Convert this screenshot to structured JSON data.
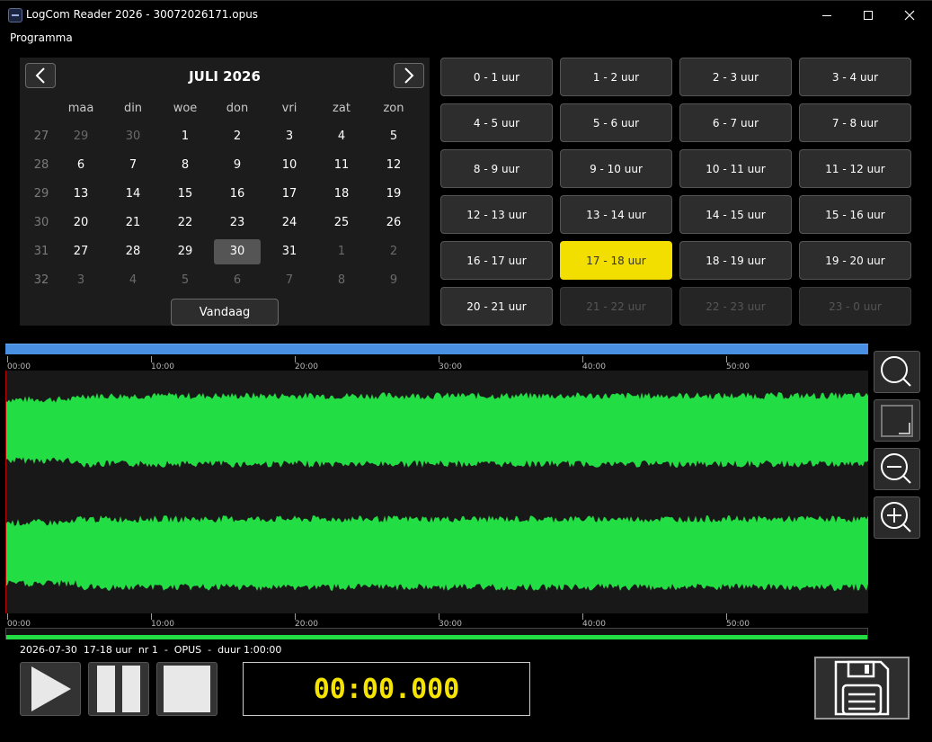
{
  "window": {
    "title": "LogCom Reader 2026  -  30072026171.opus",
    "icon": "app-icon",
    "controls": [
      "minimize-icon",
      "maximize-icon",
      "close-icon"
    ]
  },
  "menu": {
    "items": [
      "Programma"
    ]
  },
  "calendar": {
    "month_label": "JULI 2026",
    "weekday_headers": [
      "maa",
      "din",
      "woe",
      "don",
      "vri",
      "zat",
      "zon"
    ],
    "weeks": [
      {
        "week": "27",
        "days": [
          {
            "d": "29",
            "other": true
          },
          {
            "d": "30",
            "other": true
          },
          {
            "d": "1"
          },
          {
            "d": "2"
          },
          {
            "d": "3"
          },
          {
            "d": "4"
          },
          {
            "d": "5"
          }
        ]
      },
      {
        "week": "28",
        "days": [
          {
            "d": "6"
          },
          {
            "d": "7"
          },
          {
            "d": "8"
          },
          {
            "d": "9"
          },
          {
            "d": "10"
          },
          {
            "d": "11"
          },
          {
            "d": "12"
          }
        ]
      },
      {
        "week": "29",
        "days": [
          {
            "d": "13"
          },
          {
            "d": "14"
          },
          {
            "d": "15"
          },
          {
            "d": "16"
          },
          {
            "d": "17"
          },
          {
            "d": "18"
          },
          {
            "d": "19"
          }
        ]
      },
      {
        "week": "30",
        "days": [
          {
            "d": "20"
          },
          {
            "d": "21"
          },
          {
            "d": "22"
          },
          {
            "d": "23"
          },
          {
            "d": "24"
          },
          {
            "d": "25"
          },
          {
            "d": "26"
          }
        ]
      },
      {
        "week": "31",
        "days": [
          {
            "d": "27"
          },
          {
            "d": "28"
          },
          {
            "d": "29"
          },
          {
            "d": "30",
            "selected": true
          },
          {
            "d": "31"
          },
          {
            "d": "1",
            "other": true
          },
          {
            "d": "2",
            "other": true
          }
        ]
      },
      {
        "week": "32",
        "days": [
          {
            "d": "3",
            "other": true
          },
          {
            "d": "4",
            "other": true
          },
          {
            "d": "5",
            "other": true
          },
          {
            "d": "6",
            "other": true
          },
          {
            "d": "7",
            "other": true
          },
          {
            "d": "8",
            "other": true
          },
          {
            "d": "9",
            "other": true
          }
        ]
      }
    ],
    "today_button": "Vandaag",
    "prev_icon": "chevron-left-icon",
    "next_icon": "chevron-right-icon"
  },
  "hours": [
    {
      "label": "0 - 1 uur",
      "state": "normal"
    },
    {
      "label": "1 - 2 uur",
      "state": "normal"
    },
    {
      "label": "2 - 3 uur",
      "state": "normal"
    },
    {
      "label": "3 - 4 uur",
      "state": "normal"
    },
    {
      "label": "4 - 5 uur",
      "state": "normal"
    },
    {
      "label": "5 - 6 uur",
      "state": "normal"
    },
    {
      "label": "6 - 7 uur",
      "state": "normal"
    },
    {
      "label": "7 - 8 uur",
      "state": "normal"
    },
    {
      "label": "8 - 9 uur",
      "state": "normal"
    },
    {
      "label": "9 - 10 uur",
      "state": "normal"
    },
    {
      "label": "10 - 11 uur",
      "state": "normal"
    },
    {
      "label": "11 - 12 uur",
      "state": "normal"
    },
    {
      "label": "12 - 13 uur",
      "state": "normal"
    },
    {
      "label": "13 - 14 uur",
      "state": "normal"
    },
    {
      "label": "14 - 15 uur",
      "state": "normal"
    },
    {
      "label": "15 - 16 uur",
      "state": "normal"
    },
    {
      "label": "16 - 17 uur",
      "state": "normal"
    },
    {
      "label": "17 - 18 uur",
      "state": "active"
    },
    {
      "label": "18 - 19 uur",
      "state": "normal"
    },
    {
      "label": "19 - 20 uur",
      "state": "normal"
    },
    {
      "label": "20 - 21 uur",
      "state": "normal"
    },
    {
      "label": "21 - 22 uur",
      "state": "disabled"
    },
    {
      "label": "22 - 23 uur",
      "state": "disabled"
    },
    {
      "label": "23 - 0 uur",
      "state": "disabled"
    }
  ],
  "waveform": {
    "timeline_labels": [
      "00:00",
      "10:00",
      "20:00",
      "30:00",
      "40:00",
      "50:00"
    ],
    "wave_color": "#22dd44",
    "scrollbar_color": "#4a90e2",
    "cursor_color": "#bb0000"
  },
  "zoom_tools": [
    "zoom-icon",
    "zoom-fit-icon",
    "zoom-out-icon",
    "zoom-in-icon"
  ],
  "info": {
    "text": "2026-07-30  17-18 uur  nr 1  -  OPUS  -  duur 1:00:00"
  },
  "transport": {
    "play_icon": "play-icon",
    "pause_icon": "pause-icon",
    "stop_icon": "stop-icon",
    "time": "00:00.000",
    "time_color": "#f5e400",
    "save_icon": "save-icon"
  }
}
